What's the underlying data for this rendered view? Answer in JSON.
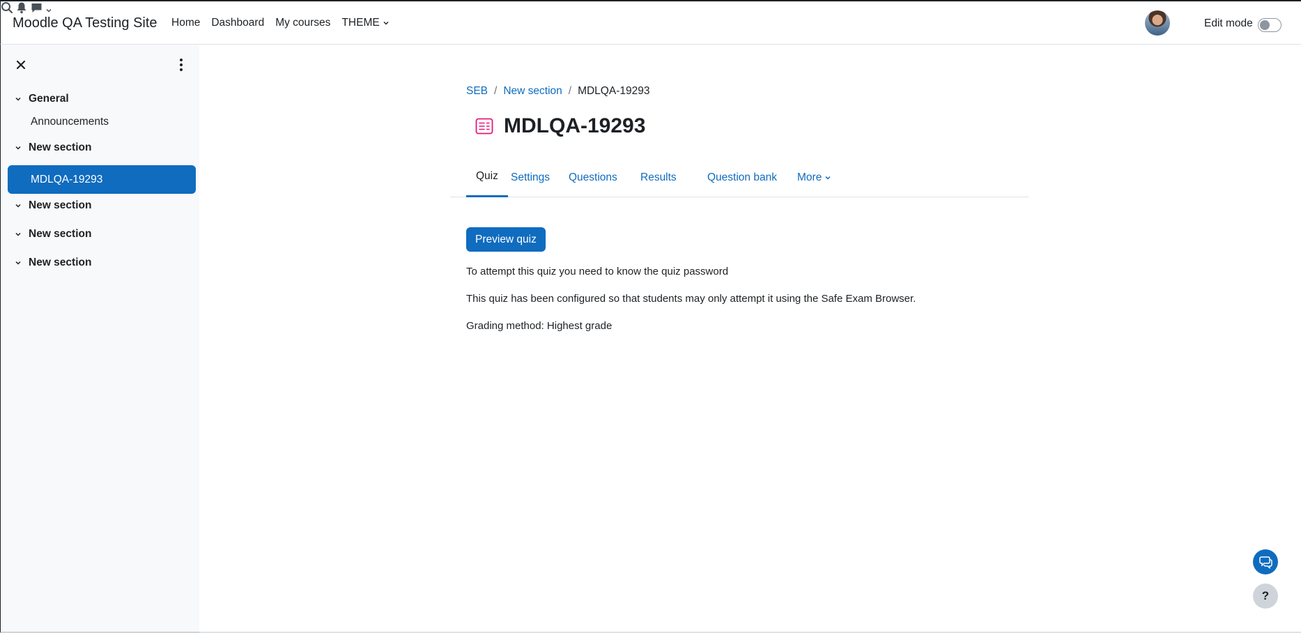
{
  "navbar": {
    "brand": "Moodle QA Testing Site",
    "links": [
      "Home",
      "Dashboard",
      "My courses"
    ],
    "theme_menu": "THEME",
    "edit_mode_label": "Edit mode",
    "edit_mode_on": false
  },
  "drawer": {
    "sections": [
      {
        "label": "General",
        "expanded": true
      },
      {
        "label": "New section",
        "expanded": true
      },
      {
        "label": "New section",
        "expanded": true
      },
      {
        "label": "New section",
        "expanded": true
      },
      {
        "label": "New section",
        "expanded": true
      }
    ],
    "items": [
      {
        "label": "Announcements",
        "active": false
      },
      {
        "label": "MDLQA-19293",
        "active": true
      }
    ]
  },
  "breadcrumb": {
    "items": [
      "SEB",
      "New section"
    ],
    "current": "MDLQA-19293"
  },
  "page": {
    "title": "MDLQA-19293",
    "icon": "quiz-icon"
  },
  "tabs": [
    {
      "label": "Quiz",
      "active": true
    },
    {
      "label": "Settings",
      "active": false
    },
    {
      "label": "Questions",
      "active": false
    },
    {
      "label": "Results",
      "active": false
    },
    {
      "label": "Question bank",
      "active": false
    },
    {
      "label": "More",
      "active": false
    }
  ],
  "content": {
    "preview_button": "Preview quiz",
    "password_notice": "To attempt this quiz you need to know the quiz password",
    "seb_notice": "This quiz has been configured so that students may only attempt it using the Safe Exam Browser.",
    "grading_method": "Grading method: Highest grade"
  },
  "floating": {
    "help_label": "?"
  },
  "colors": {
    "primary": "#0f6cbf",
    "text": "#1d2125",
    "drawer_bg": "#f8f9fa",
    "quiz_icon": "#e5197a"
  }
}
